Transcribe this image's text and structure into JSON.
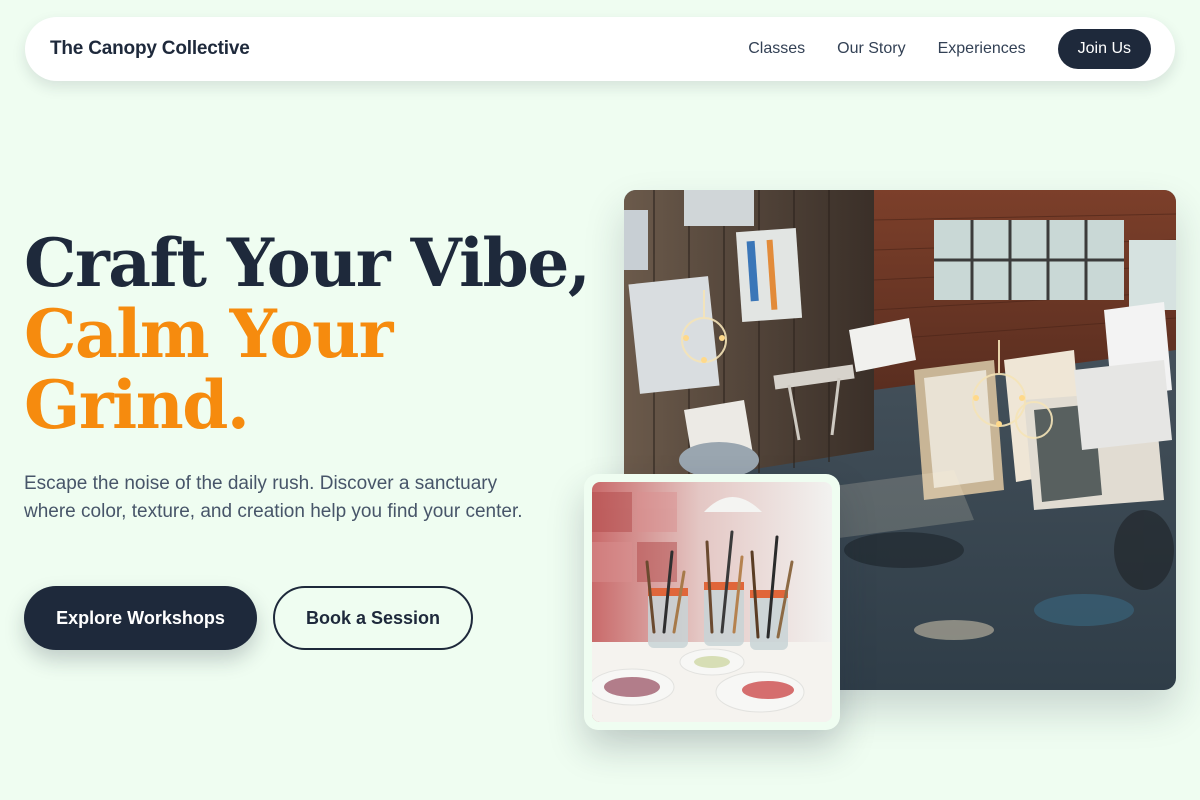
{
  "nav": {
    "brand": "The Canopy Collective",
    "links": [
      "Classes",
      "Our Story",
      "Experiences"
    ],
    "cta": "Join Us"
  },
  "hero": {
    "headline_line1": "Craft Your Vibe,",
    "headline_line2": "Calm Your",
    "headline_line3": "Grind.",
    "description": "Escape the noise of the daily rush. Discover a sanctuary where color, texture, and creation help you find your center.",
    "primary_cta": "Explore Workshops",
    "secondary_cta": "Book a Session"
  },
  "images": {
    "main": "art-studio-photo",
    "inset": "paint-brushes-photo"
  },
  "colors": {
    "background": "#effdf1",
    "navy": "#1e293b",
    "accent": "#f68b0e",
    "body_text": "#475569"
  }
}
